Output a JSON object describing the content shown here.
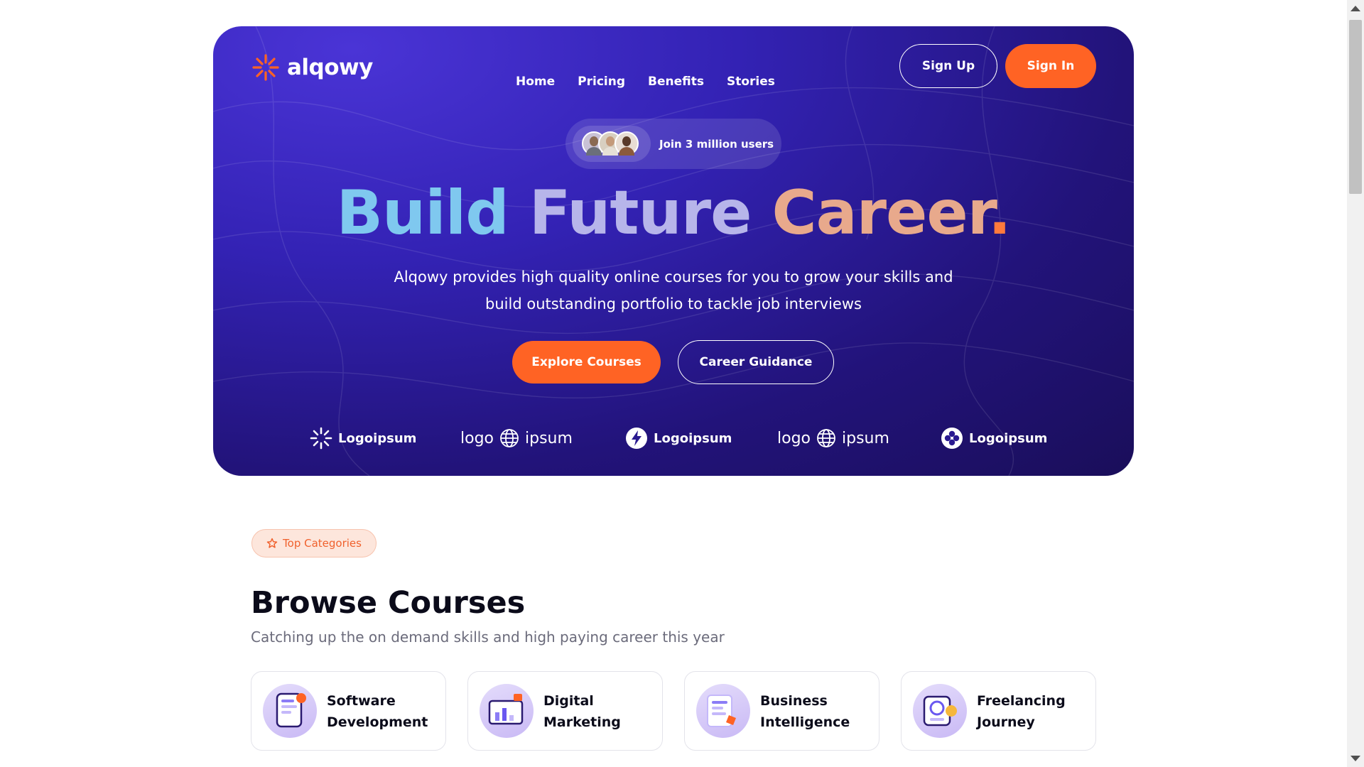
{
  "nav": {
    "brand": "alqowy",
    "links": [
      "Home",
      "Pricing",
      "Benefits",
      "Stories"
    ],
    "signup": "Sign Up",
    "signin": "Sign In"
  },
  "hero": {
    "users_text": "Join 3 million users",
    "headline": {
      "w1": "Build",
      "w2": "Future",
      "w3": "Career",
      "dot": "."
    },
    "subcopy": "Alqowy provides high quality online courses for you to grow your skills and build outstanding portfolio to tackle job interviews",
    "explore": "Explore Courses",
    "guidance": "Career Guidance",
    "partners": [
      {
        "label": "Logoipsum",
        "icon": "sunburst-logo-icon"
      },
      {
        "label_left": "logo",
        "label_right": "ipsum",
        "icon": "globe-logo-icon"
      },
      {
        "label": "Logoipsum",
        "icon": "bolt-logo-icon"
      },
      {
        "label_left": "logo",
        "label_right": "ipsum",
        "icon": "globe-logo-icon"
      },
      {
        "label": "Logoipsum",
        "icon": "clover-logo-icon"
      }
    ]
  },
  "categories": {
    "badge": "Top Categories",
    "title": "Browse Courses",
    "subtitle": "Catching up the on demand skills and high paying career this year",
    "cards": [
      {
        "line1": "Software",
        "line2": "Development",
        "icon": "software-illustration"
      },
      {
        "line1": "Digital",
        "line2": "Marketing",
        "icon": "marketing-illustration"
      },
      {
        "line1": "Business",
        "line2": "Intelligence",
        "icon": "business-illustration"
      },
      {
        "line1": "Freelancing",
        "line2": "Journey",
        "icon": "freelance-illustration"
      }
    ]
  },
  "colors": {
    "accent": "#ff6324",
    "hero_bg": "#3322b4",
    "hero_dark": "#1a0e5a"
  }
}
